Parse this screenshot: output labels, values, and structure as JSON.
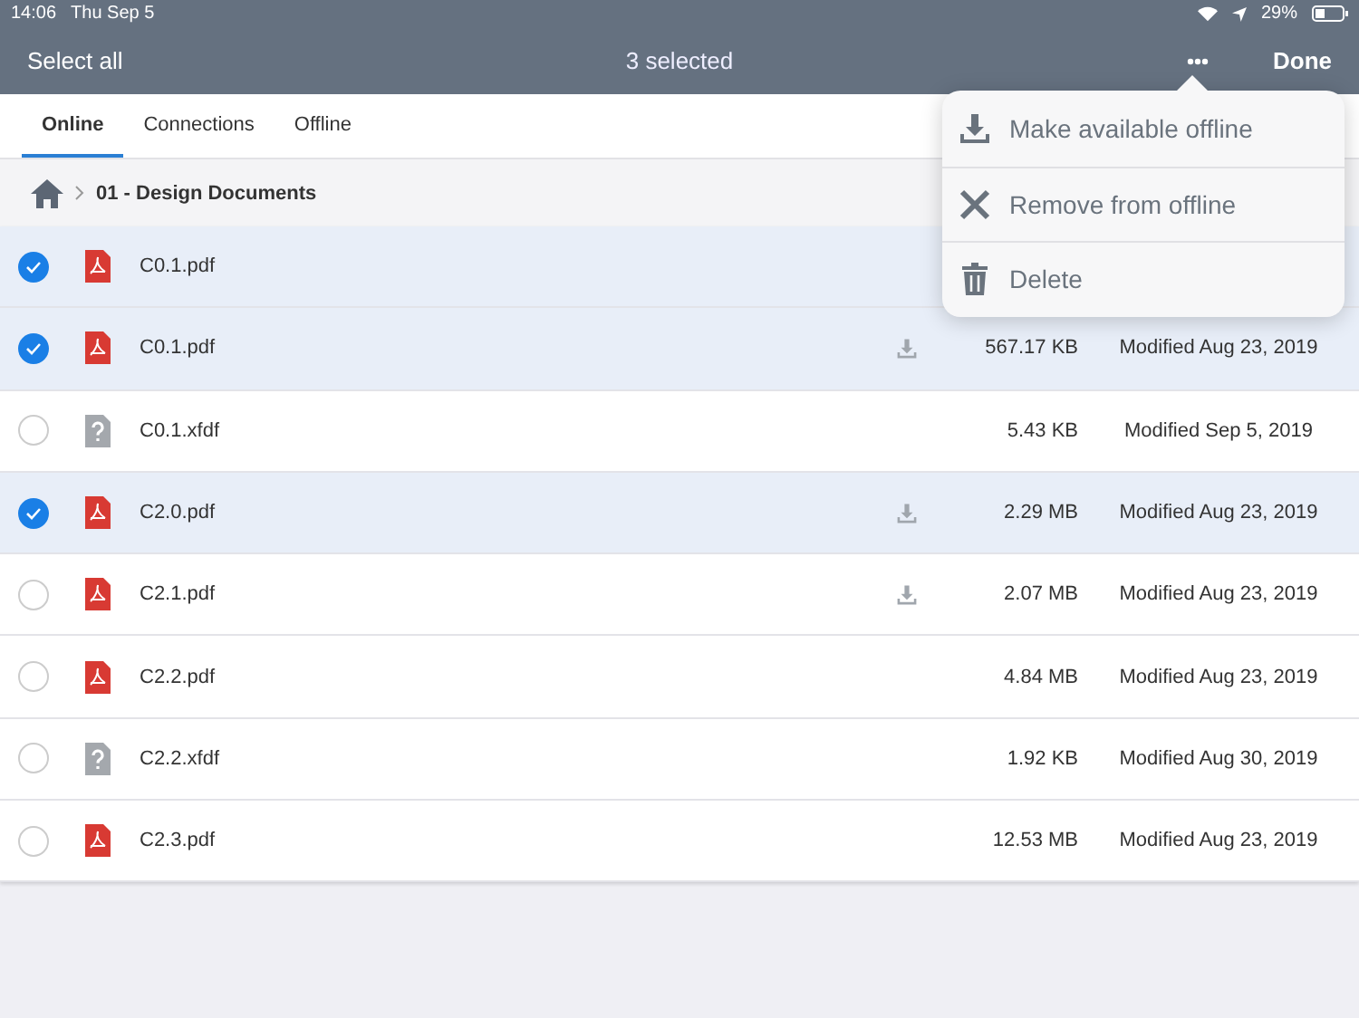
{
  "status_bar": {
    "time": "14:06",
    "date": "Thu Sep 5",
    "battery": "29%"
  },
  "nav": {
    "left": "Select all",
    "title": "3 selected",
    "right": "Done"
  },
  "tabs": [
    {
      "label": "Online",
      "selected": true
    },
    {
      "label": "Connections",
      "selected": false
    },
    {
      "label": "Offline",
      "selected": false
    }
  ],
  "breadcrumb": {
    "folder": "01 - Design Documents"
  },
  "files": [
    {
      "name": "C0.1.pdf",
      "kind": "pdf",
      "selected": true
    },
    {
      "name": "C0.1.pdf",
      "kind": "pdf",
      "selected": true,
      "download": true,
      "size": "567.17 KB",
      "modified": "Modified Aug 23, 2019"
    },
    {
      "name": "C0.1.xfdf",
      "kind": "unknown",
      "selected": false,
      "download": false,
      "size": "5.43 KB",
      "modified": "Modified Sep 5, 2019"
    },
    {
      "name": "C2.0.pdf",
      "kind": "pdf",
      "selected": true,
      "download": true,
      "size": "2.29 MB",
      "modified": "Modified Aug 23, 2019"
    },
    {
      "name": "C2.1.pdf",
      "kind": "pdf",
      "selected": false,
      "download": true,
      "size": "2.07 MB",
      "modified": "Modified Aug 23, 2019"
    },
    {
      "name": "C2.2.pdf",
      "kind": "pdf",
      "selected": false,
      "download": false,
      "size": "4.84 MB",
      "modified": "Modified Aug 23, 2019"
    },
    {
      "name": "C2.2.xfdf",
      "kind": "unknown",
      "selected": false,
      "download": false,
      "size": "1.92 KB",
      "modified": "Modified Aug 30, 2019"
    },
    {
      "name": "C2.3.pdf",
      "kind": "pdf",
      "selected": false,
      "download": false,
      "size": "12.53 MB",
      "modified": "Modified Aug 23, 2019"
    }
  ],
  "menu": [
    {
      "label": "Make available offline",
      "kind": "download"
    },
    {
      "label": "Remove from offline",
      "kind": "remove"
    },
    {
      "label": "Delete",
      "kind": "delete"
    }
  ]
}
